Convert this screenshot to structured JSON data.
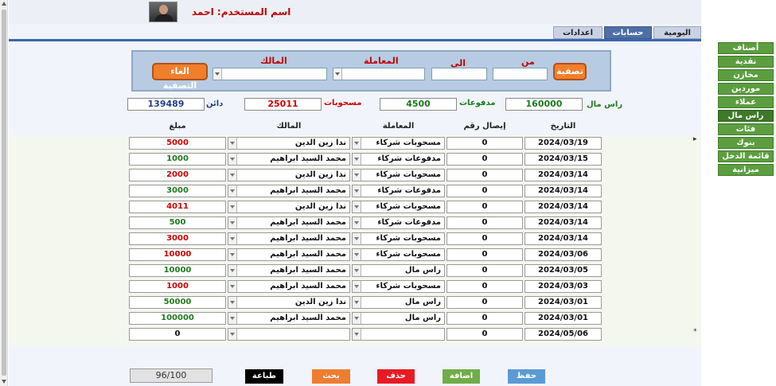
{
  "header": {
    "user_label": "اسم المستخدم: احمد"
  },
  "tabs": [
    {
      "label": "اليومية",
      "active": false
    },
    {
      "label": "حسابات",
      "active": true
    },
    {
      "label": "اعدادات",
      "active": false
    }
  ],
  "filter": {
    "from_label": "من",
    "to_label": "الى",
    "transaction_label": "المعاملة",
    "owner_label": "المالك",
    "from_value": "",
    "to_value": "",
    "transaction_value": "",
    "owner_value": "",
    "apply_label": "تصفية",
    "clear_label": "الغاء التصفية"
  },
  "summary": {
    "capital_label": "راس مال",
    "capital_value": "160000",
    "payments_label": "مدفوعات",
    "payments_value": "4500",
    "withdrawals_label": "مسحوبات",
    "withdrawals_value": "25011",
    "creditor_label": "دائن",
    "creditor_value": "139489"
  },
  "columns": {
    "date": "التاريخ",
    "receipt": "إيصال رقم",
    "transaction": "المعاملة",
    "owner": "المالك",
    "amount": "مبلغ"
  },
  "rows": [
    {
      "date": "2024/03/19",
      "receipt": "0",
      "transaction": "مسحوبات شركاء",
      "owner": "ندا زين الدين",
      "amount": "5000",
      "amount_color": "#d00000"
    },
    {
      "date": "2024/03/15",
      "receipt": "0",
      "transaction": "مدفوعات شركاء",
      "owner": "محمد السيد ابراهيم",
      "amount": "1000",
      "amount_color": "#1d7a1d"
    },
    {
      "date": "2024/03/14",
      "receipt": "0",
      "transaction": "مسحوبات شركاء",
      "owner": "ندا زين الدين",
      "amount": "2000",
      "amount_color": "#d00000"
    },
    {
      "date": "2024/03/14",
      "receipt": "0",
      "transaction": "مدفوعات شركاء",
      "owner": "محمد السيد ابراهيم",
      "amount": "3000",
      "amount_color": "#1d7a1d"
    },
    {
      "date": "2024/03/14",
      "receipt": "0",
      "transaction": "مسحوبات شركاء",
      "owner": "ندا زين الدين",
      "amount": "4011",
      "amount_color": "#d00000"
    },
    {
      "date": "2024/03/14",
      "receipt": "0",
      "transaction": "مدفوعات شركاء",
      "owner": "محمد السيد ابراهيم",
      "amount": "500",
      "amount_color": "#1d7a1d"
    },
    {
      "date": "2024/03/14",
      "receipt": "0",
      "transaction": "مسحوبات شركاء",
      "owner": "محمد السيد ابراهيم",
      "amount": "3000",
      "amount_color": "#d00000"
    },
    {
      "date": "2024/03/06",
      "receipt": "0",
      "transaction": "مسحوبات شركاء",
      "owner": "محمد السيد ابراهيم",
      "amount": "10000",
      "amount_color": "#d00000"
    },
    {
      "date": "2024/03/05",
      "receipt": "0",
      "transaction": "راس مال",
      "owner": "محمد السيد ابراهيم",
      "amount": "10000",
      "amount_color": "#1d7a1d"
    },
    {
      "date": "2024/03/03",
      "receipt": "0",
      "transaction": "مسحوبات شركاء",
      "owner": "محمد السيد ابراهيم",
      "amount": "1000",
      "amount_color": "#d00000"
    },
    {
      "date": "2024/03/01",
      "receipt": "0",
      "transaction": "راس مال",
      "owner": "ندا زين الدين",
      "amount": "50000",
      "amount_color": "#1d7a1d"
    },
    {
      "date": "2024/03/01",
      "receipt": "0",
      "transaction": "راس مال",
      "owner": "محمد السيد ابراهيم",
      "amount": "100000",
      "amount_color": "#1d7a1d"
    },
    {
      "date": "2024/05/06",
      "receipt": "0",
      "transaction": "",
      "owner": "",
      "amount": "0",
      "amount_color": "#111111"
    }
  ],
  "record_marks": {
    "current": "▸",
    "new": "*"
  },
  "footer": {
    "counter": "96/100",
    "save_label": "حفظ",
    "add_label": "اضافة",
    "delete_label": "حذف",
    "search_label": "بحث",
    "print_label": "طباعة"
  },
  "colors": {
    "save": "#5b9bd5",
    "add": "#70ad47",
    "delete": "#e81b23",
    "search": "#ed7d31",
    "print": "#000000",
    "nav": "#5c9e3f"
  },
  "nav": [
    {
      "label": "أصناف",
      "active": false
    },
    {
      "label": "نقدية",
      "active": false
    },
    {
      "label": "مخازن",
      "active": false
    },
    {
      "label": "موردين",
      "active": false
    },
    {
      "label": "عملاء",
      "active": false
    },
    {
      "label": "راس مال",
      "active": true
    },
    {
      "label": "فئات",
      "active": false
    },
    {
      "label": "بنوك",
      "active": false
    },
    {
      "label": "قائمة الدخل",
      "active": false
    },
    {
      "label": "ميزانية",
      "active": false
    }
  ]
}
